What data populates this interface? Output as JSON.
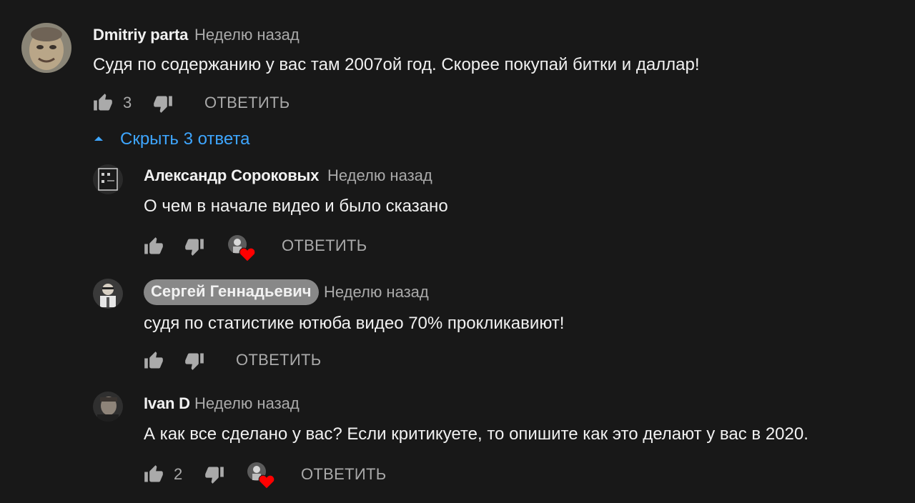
{
  "comments": [
    {
      "author": "Dmitriy parta",
      "time": "Неделю назад",
      "text": "Судя по содержанию у вас там 2007ой год. Скорее покупай битки и даллар!",
      "likes": "3",
      "reply_label": "ОТВЕТИТЬ"
    }
  ],
  "hide_replies_label": "Скрыть 3 ответа",
  "replies": [
    {
      "author": "Александр Сороковых",
      "time": "Неделю назад",
      "text": "О чем в начале видео и было сказано",
      "likes": "",
      "reply_label": "ОТВЕТИТЬ",
      "creator_heart": true
    },
    {
      "author": "Сергей Геннадьевич",
      "author_is_channel_owner": true,
      "time": "Неделю назад",
      "text": "судя по статистике ютюба видео 70% прокликавиют!",
      "likes": "",
      "reply_label": "ОТВЕТИТЬ",
      "creator_heart": false
    },
    {
      "author": "Ivan D",
      "time": "Неделю назад",
      "text": "А как все сделано у вас? Если критикуете, то опишите как это делают у вас в 2020.",
      "likes": "2",
      "reply_label": "ОТВЕТИТЬ",
      "creator_heart": true
    }
  ],
  "colors": {
    "background": "#181818",
    "link": "#3ea6ff",
    "muted": "#aaaaaa",
    "heart": "#ff0000"
  },
  "icons": [
    "like-icon",
    "dislike-icon",
    "chevron-up-icon",
    "heart-icon"
  ]
}
